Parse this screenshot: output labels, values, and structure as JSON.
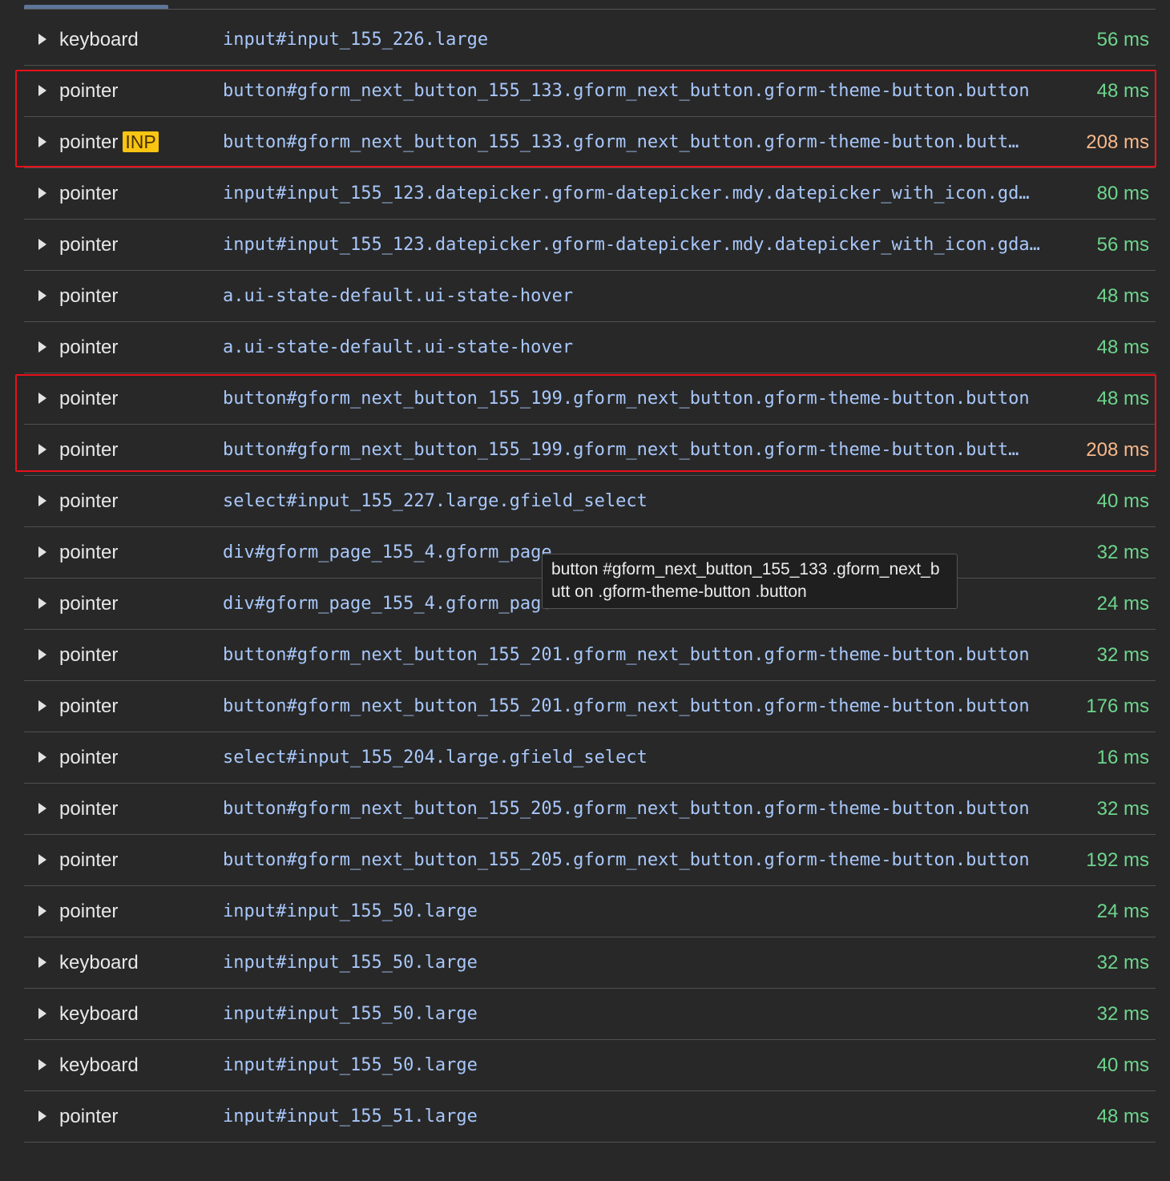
{
  "interactions": [
    {
      "type": "keyboard",
      "badge": "",
      "tag": "input",
      "selector_rest": "#input_155_226.large",
      "duration": "56 ms",
      "status": "good"
    },
    {
      "type": "pointer",
      "badge": "",
      "tag": "button",
      "selector_rest": "#gform_next_button_155_133.gform_next_button.gform-theme-button.button",
      "duration": "48 ms",
      "status": "good"
    },
    {
      "type": "pointer",
      "badge": "INP",
      "tag": "button",
      "selector_rest": "#gform_next_button_155_133.gform_next_button.gform-theme-button.butt…",
      "duration": "208 ms",
      "status": "warn"
    },
    {
      "type": "pointer",
      "badge": "",
      "tag": "input",
      "selector_rest": "#input_155_123.datepicker.gform-datepicker.mdy.datepicker_with_icon.gd…",
      "duration": "80 ms",
      "status": "good"
    },
    {
      "type": "pointer",
      "badge": "",
      "tag": "input",
      "selector_rest": "#input_155_123.datepicker.gform-datepicker.mdy.datepicker_with_icon.gda…",
      "duration": "56 ms",
      "status": "good"
    },
    {
      "type": "pointer",
      "badge": "",
      "tag": "a",
      "selector_rest": ".ui-state-default.ui-state-hover",
      "duration": "48 ms",
      "status": "good"
    },
    {
      "type": "pointer",
      "badge": "",
      "tag": "a",
      "selector_rest": ".ui-state-default.ui-state-hover",
      "duration": "48 ms",
      "status": "good"
    },
    {
      "type": "pointer",
      "badge": "",
      "tag": "button",
      "selector_rest": "#gform_next_button_155_199.gform_next_button.gform-theme-button.button",
      "duration": "48 ms",
      "status": "good"
    },
    {
      "type": "pointer",
      "badge": "",
      "tag": "button",
      "selector_rest": "#gform_next_button_155_199.gform_next_button.gform-theme-button.butt…",
      "duration": "208 ms",
      "status": "warn"
    },
    {
      "type": "pointer",
      "badge": "",
      "tag": "select",
      "selector_rest": "#input_155_227.large.gfield_select",
      "duration": "40 ms",
      "status": "good"
    },
    {
      "type": "pointer",
      "badge": "",
      "tag": "div",
      "selector_rest": "#gform_page_155_4.gform_page",
      "duration": "32 ms",
      "status": "good"
    },
    {
      "type": "pointer",
      "badge": "",
      "tag": "div",
      "selector_rest": "#gform_page_155_4.gform_page",
      "duration": "24 ms",
      "status": "good"
    },
    {
      "type": "pointer",
      "badge": "",
      "tag": "button",
      "selector_rest": "#gform_next_button_155_201.gform_next_button.gform-theme-button.button",
      "duration": "32 ms",
      "status": "good"
    },
    {
      "type": "pointer",
      "badge": "",
      "tag": "button",
      "selector_rest": "#gform_next_button_155_201.gform_next_button.gform-theme-button.button",
      "duration": "176 ms",
      "status": "good"
    },
    {
      "type": "pointer",
      "badge": "",
      "tag": "select",
      "selector_rest": "#input_155_204.large.gfield_select",
      "duration": "16 ms",
      "status": "good"
    },
    {
      "type": "pointer",
      "badge": "",
      "tag": "button",
      "selector_rest": "#gform_next_button_155_205.gform_next_button.gform-theme-button.button",
      "duration": "32 ms",
      "status": "good"
    },
    {
      "type": "pointer",
      "badge": "",
      "tag": "button",
      "selector_rest": "#gform_next_button_155_205.gform_next_button.gform-theme-button.button",
      "duration": "192 ms",
      "status": "good"
    },
    {
      "type": "pointer",
      "badge": "",
      "tag": "input",
      "selector_rest": "#input_155_50.large",
      "duration": "24 ms",
      "status": "good"
    },
    {
      "type": "keyboard",
      "badge": "",
      "tag": "input",
      "selector_rest": "#input_155_50.large",
      "duration": "32 ms",
      "status": "good"
    },
    {
      "type": "keyboard",
      "badge": "",
      "tag": "input",
      "selector_rest": "#input_155_50.large",
      "duration": "32 ms",
      "status": "good"
    },
    {
      "type": "keyboard",
      "badge": "",
      "tag": "input",
      "selector_rest": "#input_155_50.large",
      "duration": "40 ms",
      "status": "good"
    },
    {
      "type": "pointer",
      "badge": "",
      "tag": "input",
      "selector_rest": "#input_155_51.large",
      "duration": "48 ms",
      "status": "good"
    }
  ],
  "tooltip": {
    "text": "button #gform_next_button_155_133 .gform_next_butt on .gform-theme-button .button"
  },
  "colors": {
    "background": "#282828",
    "selector": "#a8c7fa",
    "duration_good": "#6dd58c",
    "duration_warn": "#f8b88b",
    "inp_badge": "#f9c513",
    "highlight": "#e8101b"
  }
}
